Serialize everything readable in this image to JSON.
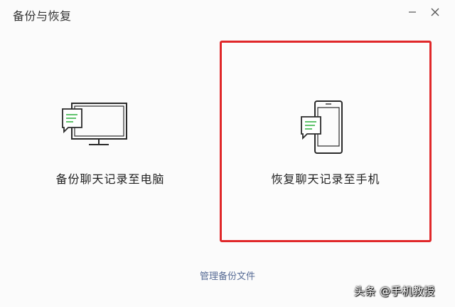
{
  "window": {
    "title": "备份与恢复",
    "minimize_symbol": "−",
    "close_symbol": "×"
  },
  "options": [
    {
      "label": "备份聊天记录至电脑",
      "icon": "monitor-chat-icon",
      "selected": false
    },
    {
      "label": "恢复聊天记录至手机",
      "icon": "phone-chat-icon",
      "selected": true
    }
  ],
  "footer": {
    "manage_link": "管理备份文件"
  },
  "watermark": "头条 @手机教授",
  "colors": {
    "highlight": "#e0282a",
    "link": "#576b95",
    "chat_lines": "#3bb54a"
  }
}
